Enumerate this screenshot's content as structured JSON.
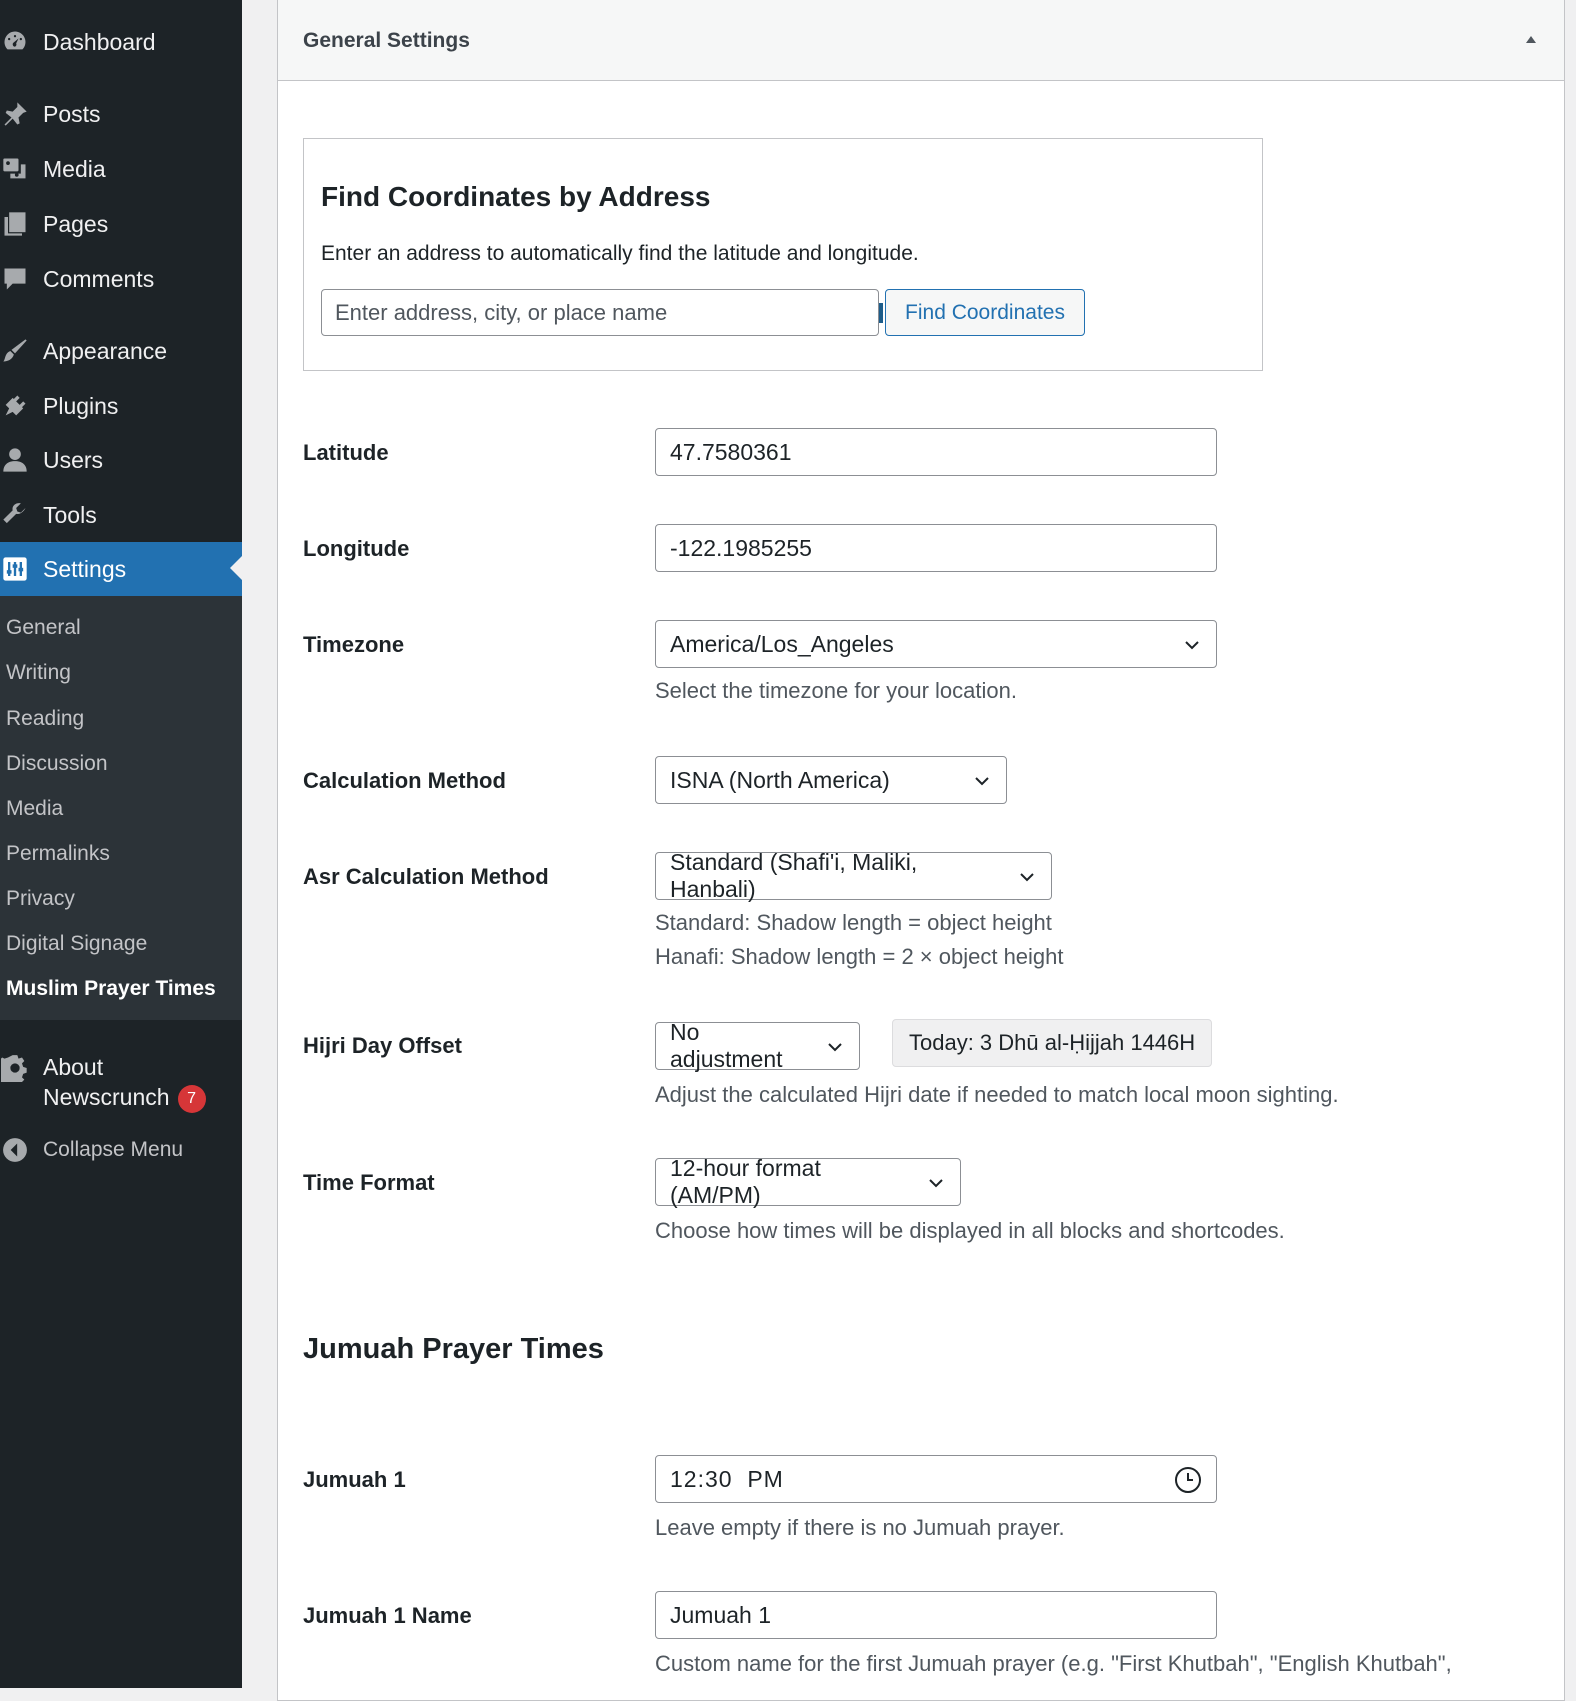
{
  "sidebar": {
    "items": [
      {
        "label": "Dashboard",
        "icon": "dashboard-icon"
      },
      {
        "label": "Posts",
        "icon": "pushpin-icon"
      },
      {
        "label": "Media",
        "icon": "media-icon"
      },
      {
        "label": "Pages",
        "icon": "pages-icon"
      },
      {
        "label": "Comments",
        "icon": "comment-icon"
      },
      {
        "label": "Appearance",
        "icon": "paintbrush-icon"
      },
      {
        "label": "Plugins",
        "icon": "plugin-icon"
      },
      {
        "label": "Users",
        "icon": "user-icon"
      },
      {
        "label": "Tools",
        "icon": "wrench-icon"
      },
      {
        "label": "Settings",
        "icon": "settings-icon"
      }
    ],
    "submenu": [
      "General",
      "Writing",
      "Reading",
      "Discussion",
      "Media",
      "Permalinks",
      "Privacy",
      "Digital Signage",
      "Muslim Prayer Times"
    ],
    "about": {
      "line1": "About",
      "line2": "Newscrunch",
      "badge": "7"
    },
    "collapse_label": "Collapse Menu"
  },
  "panel": {
    "title": "General Settings"
  },
  "geo": {
    "title": "Find Coordinates by Address",
    "description": "Enter an address to automatically find the latitude and longitude.",
    "placeholder": "Enter address, city, or place name",
    "button": "Find Coordinates"
  },
  "form": {
    "latitude": {
      "label": "Latitude",
      "value": "47.7580361"
    },
    "longitude": {
      "label": "Longitude",
      "value": "-122.1985255"
    },
    "timezone": {
      "label": "Timezone",
      "value": "America/Los_Angeles",
      "desc": "Select the timezone for your location."
    },
    "calc_method": {
      "label": "Calculation Method",
      "value": "ISNA (North America)"
    },
    "asr_method": {
      "label": "Asr Calculation Method",
      "value": "Standard (Shafi'i, Maliki, Hanbali)",
      "desc1": "Standard: Shadow length = object height",
      "desc2": "Hanafi: Shadow length = 2 × object height"
    },
    "hijri": {
      "label": "Hijri Day Offset",
      "value": "No adjustment",
      "today": "Today: 3 Dhū al-Ḥijjah 1446H",
      "desc": "Adjust the calculated Hijri date if needed to match local moon sighting."
    },
    "time_format": {
      "label": "Time Format",
      "value": "12-hour format (AM/PM)",
      "desc": "Choose how times will be displayed in all blocks and shortcodes."
    }
  },
  "jumuah": {
    "heading": "Jumuah Prayer Times",
    "j1": {
      "label": "Jumuah 1",
      "value": "12:30  PM",
      "desc": "Leave empty if there is no Jumuah prayer."
    },
    "j1_name": {
      "label": "Jumuah 1 Name",
      "value": "Jumuah 1",
      "desc": "Custom name for the first Jumuah prayer (e.g. \"First Khutbah\", \"English Khutbah\","
    }
  },
  "colors": {
    "sidebar_bg": "#1d2327",
    "submenu_bg": "#2c3338",
    "accent": "#2271b1",
    "badge": "#d63638"
  }
}
